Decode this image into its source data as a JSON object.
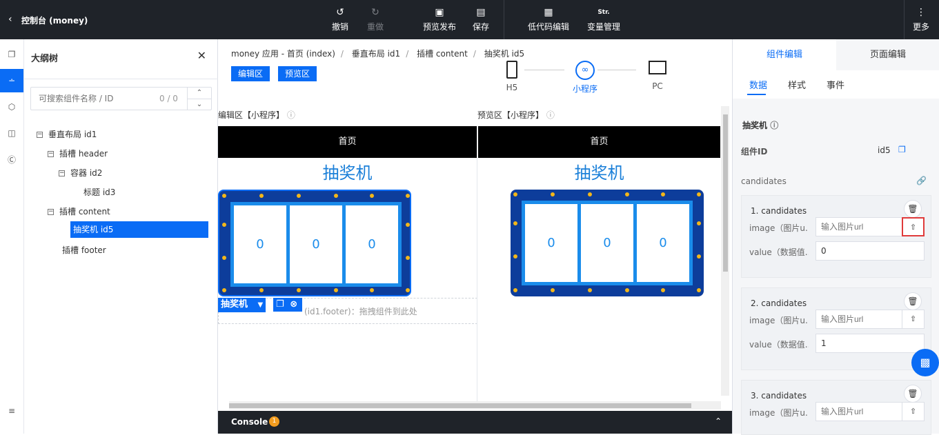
{
  "topbar": {
    "back_icon": "chevron-left-icon",
    "title": "控制台 (money)",
    "undo": "撤销",
    "redo": "重做",
    "preview_publish": "预览发布",
    "save": "保存",
    "lowcode_edit": "低代码编辑",
    "var_icon": "Str.",
    "var_manage": "变量管理",
    "more": "更多"
  },
  "outline": {
    "title": "大纲树",
    "search_placeholder": "可搜索组件名称 / ID",
    "search_count": "0 / 0",
    "tree": [
      {
        "label": "垂直布局 id1",
        "toggle": "−"
      },
      {
        "label": "插槽 header",
        "toggle": "−"
      },
      {
        "label": "容器 id2",
        "toggle": "−"
      },
      {
        "label": "标题 id3",
        "toggle": ""
      },
      {
        "label": "插槽 content",
        "toggle": "−"
      },
      {
        "label": "抽奖机 id5",
        "toggle": ""
      },
      {
        "label": "插槽 footer",
        "toggle": ""
      }
    ]
  },
  "center": {
    "breadcrumb": [
      "money 应用 - 首页 (index)",
      "垂直布局 id1",
      "插槽 content",
      "抽奖机 id5"
    ],
    "edit_zone_btn": "编辑区",
    "preview_zone_btn": "预览区",
    "devices": [
      {
        "label": "H5"
      },
      {
        "label": "小程序"
      },
      {
        "label": "PC"
      }
    ],
    "edit_zone_label": "编辑区【小程序】",
    "preview_zone_label": "预览区【小程序】",
    "page_title": "首页",
    "lottery_title": "抽奖机",
    "reels": [
      "0",
      "0",
      "0"
    ],
    "drop_hint": "(id1.footer)：拖拽组件到此处",
    "selected_tag": "抽奖机",
    "console_label": "Console",
    "console_count": "1"
  },
  "right": {
    "tab_component": "组件编辑",
    "tab_page": "页面编辑",
    "sub_data": "数据",
    "sub_style": "样式",
    "sub_event": "事件",
    "comp_name": "抽奖机",
    "comp_id_label": "组件ID",
    "comp_id_value": "id5",
    "candidates_label": "candidates",
    "cards": [
      {
        "title": "1. candidates",
        "image_label": "image（图片u...",
        "image_placeholder": "输入图片url",
        "value_label": "value（数据值...",
        "value": "0"
      },
      {
        "title": "2. candidates",
        "image_label": "image（图片u...",
        "image_placeholder": "输入图片url",
        "value_label": "value（数据值...",
        "value": "1"
      },
      {
        "title": "3. candidates",
        "image_label": "image（图片u...",
        "image_placeholder": "输入图片url",
        "value_label": "",
        "value": ""
      }
    ]
  },
  "colors": {
    "accent": "#0a6cf5",
    "topbar": "#1f2329",
    "machine": "#0d3d9b",
    "bulb": "#f2b61a"
  }
}
